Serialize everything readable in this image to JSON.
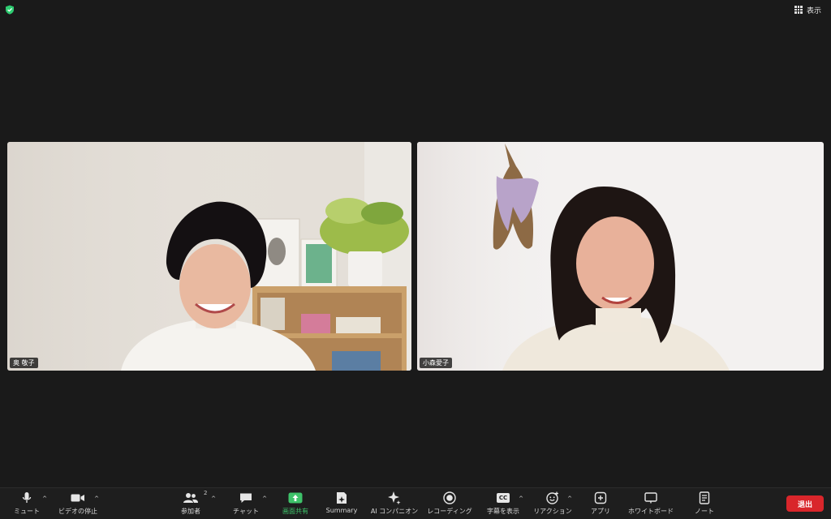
{
  "top": {
    "view_label": "表示"
  },
  "participants": [
    {
      "name": "奥 敬子"
    },
    {
      "name": "小森愛子"
    }
  ],
  "toolbar": {
    "mute": "ミュート",
    "video": "ビデオの停止",
    "participants": "参加者",
    "participants_count": "2",
    "chat": "チャット",
    "share": "画面共有",
    "summary": "Summary",
    "ai": "AI コンパニオン",
    "record": "レコーディング",
    "captions": "字幕を表示",
    "captions_icon_text": "CC",
    "reactions": "リアクション",
    "apps": "アプリ",
    "whiteboard": "ホワイトボード",
    "notes": "ノート",
    "leave": "退出"
  },
  "colors": {
    "share_accent": "#3ec36a",
    "leave": "#d9262b",
    "security_shield": "#2ecc71"
  }
}
